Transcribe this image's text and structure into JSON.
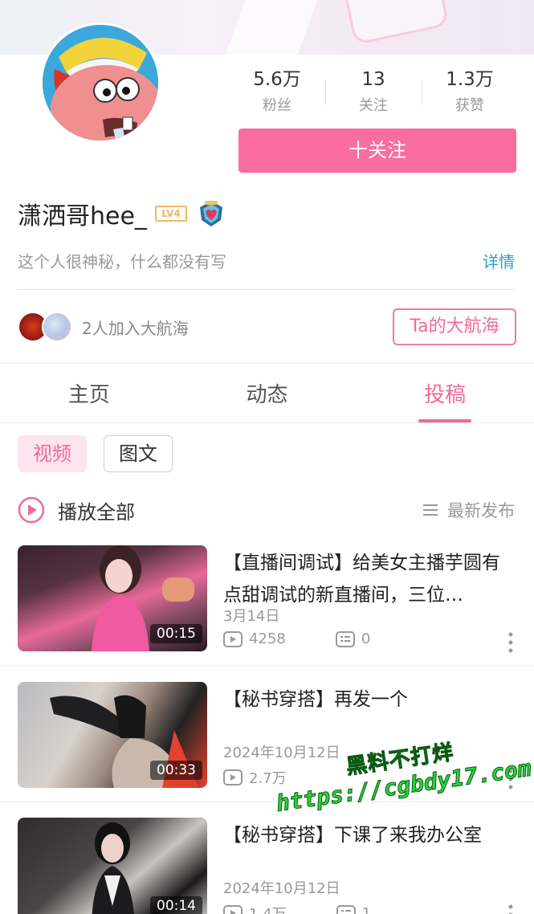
{
  "profile": {
    "followers": "5.6万",
    "followers_label": "粉丝",
    "following": "13",
    "following_label": "关注",
    "likes": "1.3万",
    "likes_label": "获赞",
    "follow_button": "十关注",
    "username": "潇洒哥hee_",
    "level": "LV4",
    "bio": "这个人很神秘，什么都没有写",
    "detail_link": "详情"
  },
  "fleet": {
    "text": "2人加入大航海",
    "button": "Ta的大航海"
  },
  "tabs": [
    {
      "label": "主页",
      "active": false
    },
    {
      "label": "动态",
      "active": false
    },
    {
      "label": "投稿",
      "active": true
    }
  ],
  "filters": {
    "video": "视频",
    "photo": "图文"
  },
  "list_header": {
    "play_all": "播放全部",
    "sort": "最新发布"
  },
  "videos": [
    {
      "title": "【直播间调试】给美女主播芋圆有点甜调试的新直播间，三位…",
      "date": "3月14日",
      "views": "4258",
      "comments": "0",
      "duration": "00:15"
    },
    {
      "title": "【秘书穿搭】再发一个",
      "date": "2024年10月12日",
      "views": "2.7万",
      "comments": "",
      "duration": "00:33"
    },
    {
      "title": "【秘书穿搭】下课了来我办公室",
      "date": "2024年10月12日",
      "views": "1.4万",
      "comments": "1",
      "duration": "00:14"
    }
  ],
  "watermark": {
    "line1": "黑料不打烊",
    "line2": "https://cgbdy17.com"
  },
  "colors": {
    "accent": "#f06a9b",
    "follow_button": "#f96d9f",
    "link": "#2aa2c6",
    "watermark": "#2bd43a"
  }
}
